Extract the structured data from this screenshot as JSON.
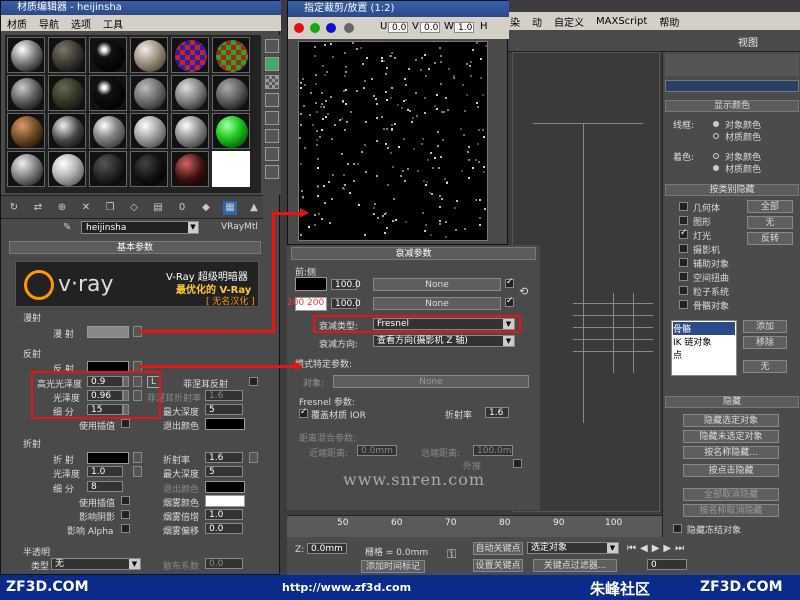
{
  "max": {
    "menu": [
      "染",
      "动",
      "自定义",
      "MAXScript",
      "帮助"
    ],
    "viewport_label": "视图"
  },
  "mat_editor": {
    "title": "材质编辑器 - heijinsha",
    "menu": [
      "材质",
      "导航",
      "选项",
      "工具"
    ],
    "name": "heijinsha",
    "type": "VRayMtl",
    "rollout_basic": "基本参数",
    "vray_title": "V-Ray 超级明暗器",
    "vray_subtitle": "最优化的 V-Ray",
    "vray_credit": "[ 无名汉化 ]",
    "vray_logo": "v·ray",
    "diffuse_group": "漫射",
    "diffuse_label": "漫 射",
    "reflect_group": "反射",
    "reflect_label": "反 射",
    "hilight_gloss_label": "高光光泽度",
    "hilight_gloss": "0.9",
    "gloss_label": "光泽度",
    "gloss": "0.96",
    "subdiv_label": "细 分",
    "subdiv": "15",
    "interp_label": "使用插值",
    "fresnel_label": "菲涅耳反射",
    "fresnel_ior_label": "菲涅耳折射率",
    "fresnel_ior": "1.6",
    "max_depth_label": "最大深度",
    "max_depth": "5",
    "exit_color_label": "退出颜色",
    "l_label": "L",
    "refract_group": "折射",
    "refract_label": "折 射",
    "r_gloss": "1.0",
    "r_subdiv": "8",
    "ior_label": "折射率",
    "ior": "1.6",
    "r_max_depth": "5",
    "r_exit_label": "退出颜色",
    "r_interp_label": "使用插值",
    "shadow_label": "影响阴影",
    "alpha_label": "影响 Alpha",
    "fog_color_label": "烟雾颜色",
    "fog_mult_label": "烟雾倍增",
    "fog_mult": "1.0",
    "fog_bias_label": "烟雾偏移",
    "fog_bias": "0.0",
    "translucent_group": "半透明",
    "type_label": "类型",
    "type_value": "无",
    "scatter_label": "散布系数",
    "scatter_value": "0.0"
  },
  "falloff_window": {
    "title": "指定裁剪/放置 (1:2)",
    "u_label": "U",
    "u": "0.0",
    "v_label": "V",
    "v": "0.0",
    "w_label": "W",
    "w": "1.0",
    "h_label": "H"
  },
  "falloff_params": {
    "rollout": "衰减参数",
    "front_side": "前:侧",
    "v1": "100.0",
    "v2": "100.0",
    "none1": "None",
    "none2": "None",
    "nums_red": "200  200",
    "type_label": "衰减类型:",
    "type_value": "Fresnel",
    "dir_label": "衰减方向:",
    "dir_value": "查看方向(摄影机 Z 轴)",
    "mode_head": "模式特定参数:",
    "object_label": "对象:",
    "object_value": "None",
    "fresnel_head": "Fresnel 参数:",
    "override_label": "覆盖材质 IOR",
    "ior_label": "折射率",
    "ior": "1.6",
    "dist_head": "距离混合参数:",
    "near_label": "近端距离:",
    "near": "0.0mm",
    "far_label": "远端距离:",
    "far": "100.0m",
    "extrap_label": "外推"
  },
  "right_panel": {
    "display_color": "显示颜色",
    "wire_label": "线框:",
    "shade_label": "着色:",
    "obj_color": "对象颜色",
    "mat_color": "材质颜色",
    "hide_by_cat": "按类别隐藏",
    "cats": [
      "几何体",
      "图形",
      "灯光",
      "摄影机",
      "辅助对象",
      "空间扭曲",
      "粒子系统",
      "骨骼对象"
    ],
    "all": "全部",
    "none": "无",
    "invert": "反转",
    "list": [
      "骨骼",
      "IK 链对象",
      "点"
    ],
    "add": "添加",
    "remove": "移除",
    "none2": "无",
    "hide": "隐藏",
    "hide_sel": "隐藏选定对象",
    "hide_unsel": "隐藏未选定对象",
    "hide_by_name": "按名称隐藏...",
    "hide_by_hit": "按点击隐藏",
    "unhide_all": "全部取消隐藏",
    "unhide_by_name": "按名称取消隐藏",
    "hide_frozen": "隐藏冻结对象"
  },
  "timeline": {
    "ticks": [
      "50",
      "60",
      "70",
      "80",
      "90",
      "100"
    ]
  },
  "status": {
    "z_label": "Z:",
    "z": "0.0mm",
    "grid_label": "栅格 = 0.0mm",
    "add_time_tag": "添加时间标记",
    "auto_key": "自动关键点",
    "set_key": "设置关键点",
    "selected": "选定对象",
    "key_filters": "关键点过滤器...",
    "frame": "0"
  },
  "watermark": "www.snren.com",
  "footer": {
    "left": "ZF3D.COM",
    "url": "http://www.zf3d.com",
    "brand": "朱峰社区",
    "right": "ZF3D.COM"
  }
}
